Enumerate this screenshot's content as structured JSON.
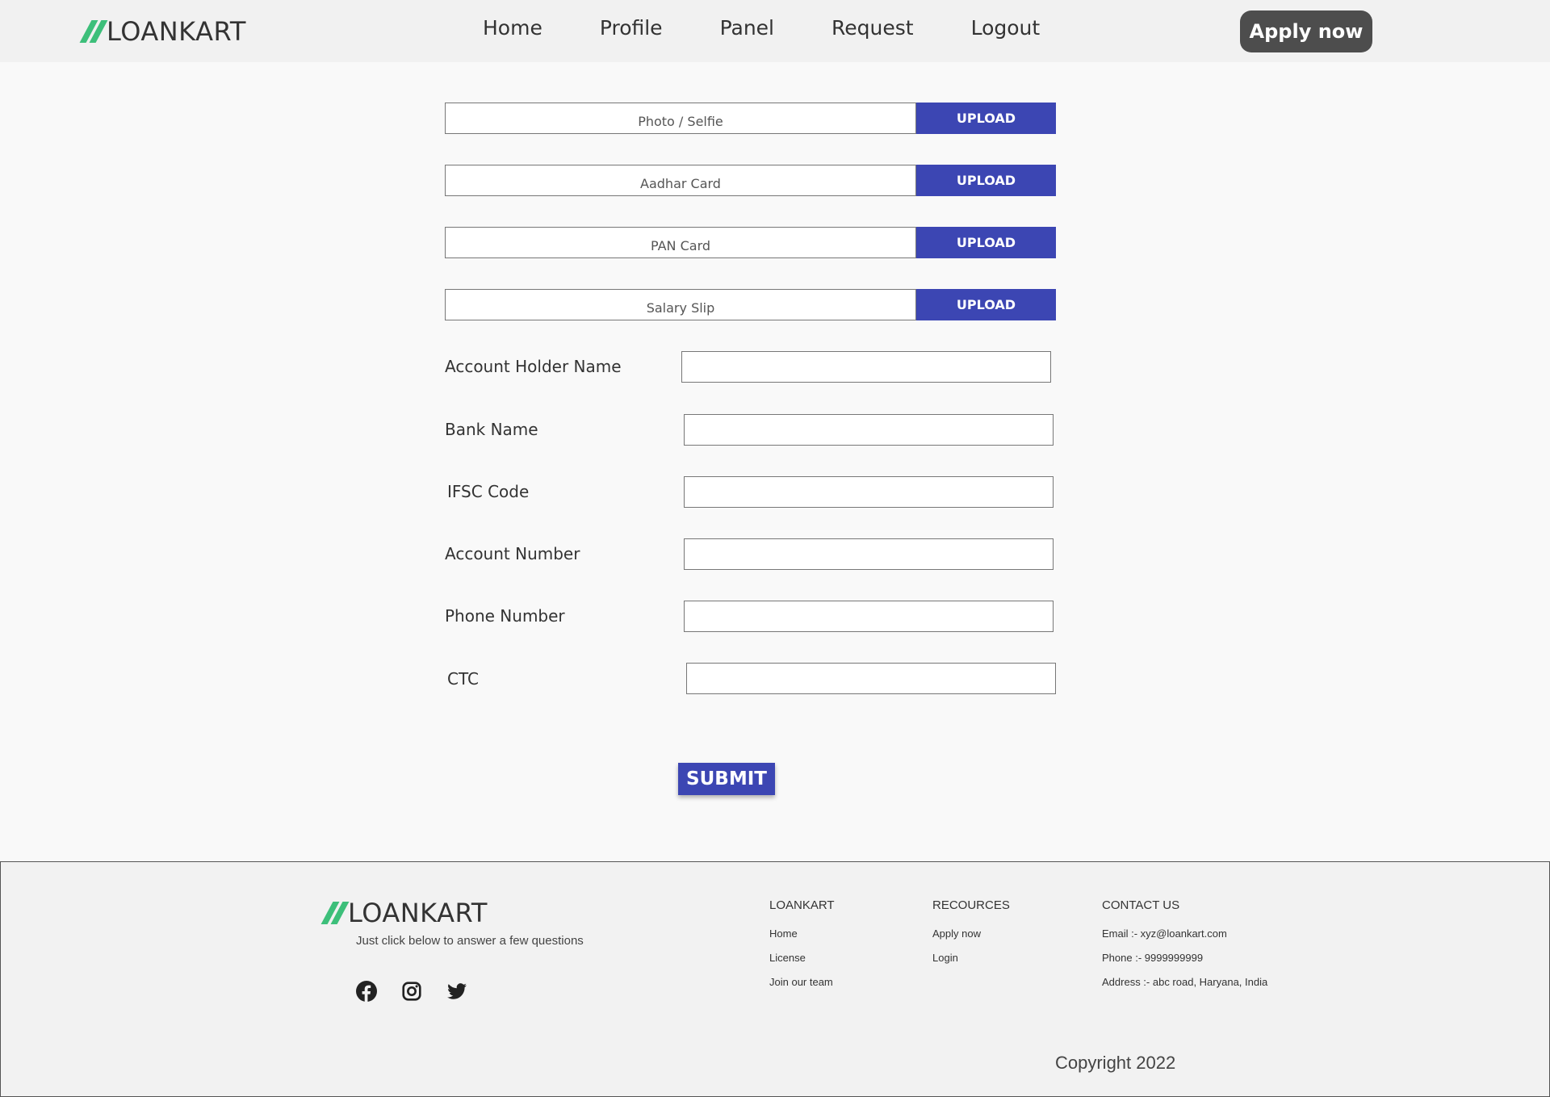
{
  "header": {
    "brand": "LOANKART",
    "nav": [
      "Home",
      "Profile",
      "Panel",
      "Request",
      "Logout"
    ],
    "apply_label": "Apply now"
  },
  "uploads": [
    {
      "label": "Photo / Selfie",
      "button": "UPLOAD"
    },
    {
      "label": "Aadhar Card",
      "button": "UPLOAD"
    },
    {
      "label": "PAN Card",
      "button": "UPLOAD"
    },
    {
      "label": "Salary Slip",
      "button": "UPLOAD"
    }
  ],
  "form": {
    "fields": [
      {
        "label": "Account Holder Name",
        "value": ""
      },
      {
        "label": "Bank Name",
        "value": ""
      },
      {
        "label": "IFSC Code",
        "value": ""
      },
      {
        "label": "Account Number",
        "value": ""
      },
      {
        "label": "Phone Number",
        "value": ""
      },
      {
        "label": "CTC",
        "value": ""
      }
    ],
    "submit_label": "SUBMIT"
  },
  "footer": {
    "brand": "LOANKART",
    "tagline": "Just click below to answer a few questions",
    "social_icons": [
      "facebook-icon",
      "instagram-icon",
      "twitter-icon"
    ],
    "columns": [
      {
        "heading": "LOANKART",
        "links": [
          "Home",
          "License",
          "Join our team"
        ]
      },
      {
        "heading": "RECOURCES",
        "links": [
          "Apply now",
          "Login"
        ]
      },
      {
        "heading": "CONTACT US",
        "links": [
          "Email :- xyz@loankart.com",
          "Phone :- 9999999999",
          "Address :-  abc road, Haryana, India"
        ]
      }
    ],
    "copyright": "Copyright 2022"
  },
  "colors": {
    "accent": "#3c46b3",
    "logo_green": "#3dbf7a",
    "apply_button": "#4d4d4d"
  }
}
